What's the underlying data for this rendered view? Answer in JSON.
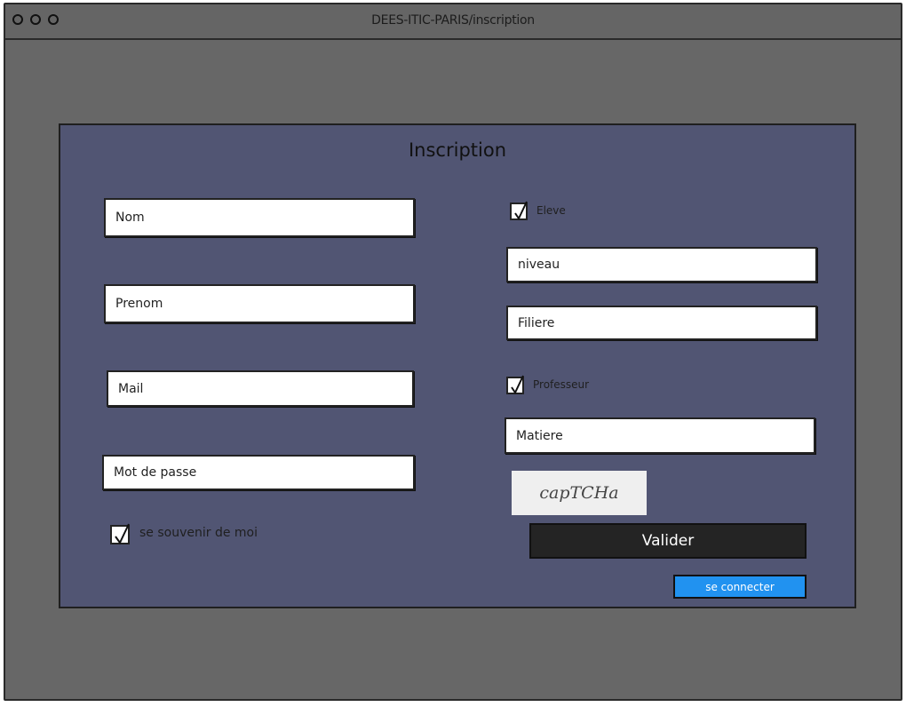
{
  "window": {
    "title": "DEES-ITIC-PARIS/inscription"
  },
  "form": {
    "title": "Inscription",
    "left_fields": {
      "nom": "Nom",
      "prenom": "Prenom",
      "mail": "Mail",
      "password": "Mot de passe"
    },
    "remember_label": "se souvenir de moi",
    "remember_checked": true,
    "eleve": {
      "label": "Eleve",
      "checked": true
    },
    "niveau": "niveau",
    "filiere": "Filiere",
    "professeur": {
      "label": "Professeur",
      "checked": true
    },
    "matiere": "Matiere",
    "captcha": "capTCHa",
    "submit_label": "Valider",
    "connect_label": "se connecter"
  },
  "colors": {
    "window_bg": "#676767",
    "panel_bg": "#515573",
    "submit_bg": "#242424",
    "connect_bg": "#2192f0"
  }
}
